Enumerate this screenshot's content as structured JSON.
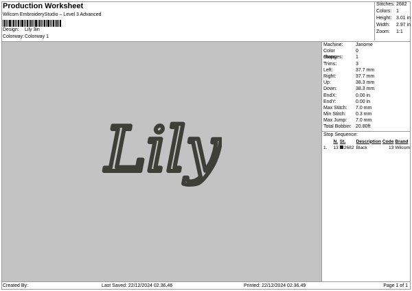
{
  "header": {
    "title": "Production Worksheet",
    "subtitle": "Wilcom EmbroideryStudio – Level 3 Advanced",
    "design_label": "Design:",
    "design_value": "Lily 3in",
    "colorway_label": "Colorway:",
    "colorway_value": "Colorway 1"
  },
  "summary": [
    {
      "label": "Stitches:",
      "value": "2682"
    },
    {
      "label": "Colors:",
      "value": "1"
    },
    {
      "label": "Height:",
      "value": "3.01 in"
    },
    {
      "label": "Width:",
      "value": "2.97 in"
    },
    {
      "label": "Zoom:",
      "value": "1:1"
    }
  ],
  "design": {
    "text": "Lily",
    "thread_color": "#3f3f3a",
    "background": "#c3c3c3"
  },
  "details": [
    {
      "label": "Machine:",
      "value": "Janome"
    },
    {
      "label": "Color changes:",
      "value": "0"
    },
    {
      "label": "Stops:",
      "value": "1"
    },
    {
      "label": "Trims:",
      "value": "3"
    },
    {
      "label": "Left:",
      "value": "37.7 mm"
    },
    {
      "label": "Right:",
      "value": "37.7 mm"
    },
    {
      "label": "Up:",
      "value": "38.3 mm"
    },
    {
      "label": "Down:",
      "value": "38.3 mm"
    },
    {
      "label": "EndX:",
      "value": "0.00 in"
    },
    {
      "label": "EndY:",
      "value": "0.00 in"
    },
    {
      "label": "Max Stitch:",
      "value": "7.0 mm"
    },
    {
      "label": "Min Stitch:",
      "value": "0.3 mm"
    },
    {
      "label": "Max Jump:",
      "value": "7.0 mm"
    },
    {
      "label": "Total Bobbin:",
      "value": "20.80ft"
    }
  ],
  "stop_sequence": {
    "title": "Stop Sequence:",
    "headers": {
      "n": "N.",
      "st": "St.",
      "description": "Description",
      "code": "Code",
      "brand": "Brand"
    },
    "rows": [
      {
        "stop": "1.",
        "n": "13",
        "st": "2682",
        "description": "Black",
        "code": "13",
        "brand": "Wilcom",
        "swatch": "#1c1c1c"
      }
    ]
  },
  "footer": {
    "created_by": "Created By:",
    "last_saved": "Last Saved: 22/12/2024 02.36.46",
    "printed": "Printed: 22/12/2024 02.36.49",
    "page": "Page 1 of 1"
  }
}
